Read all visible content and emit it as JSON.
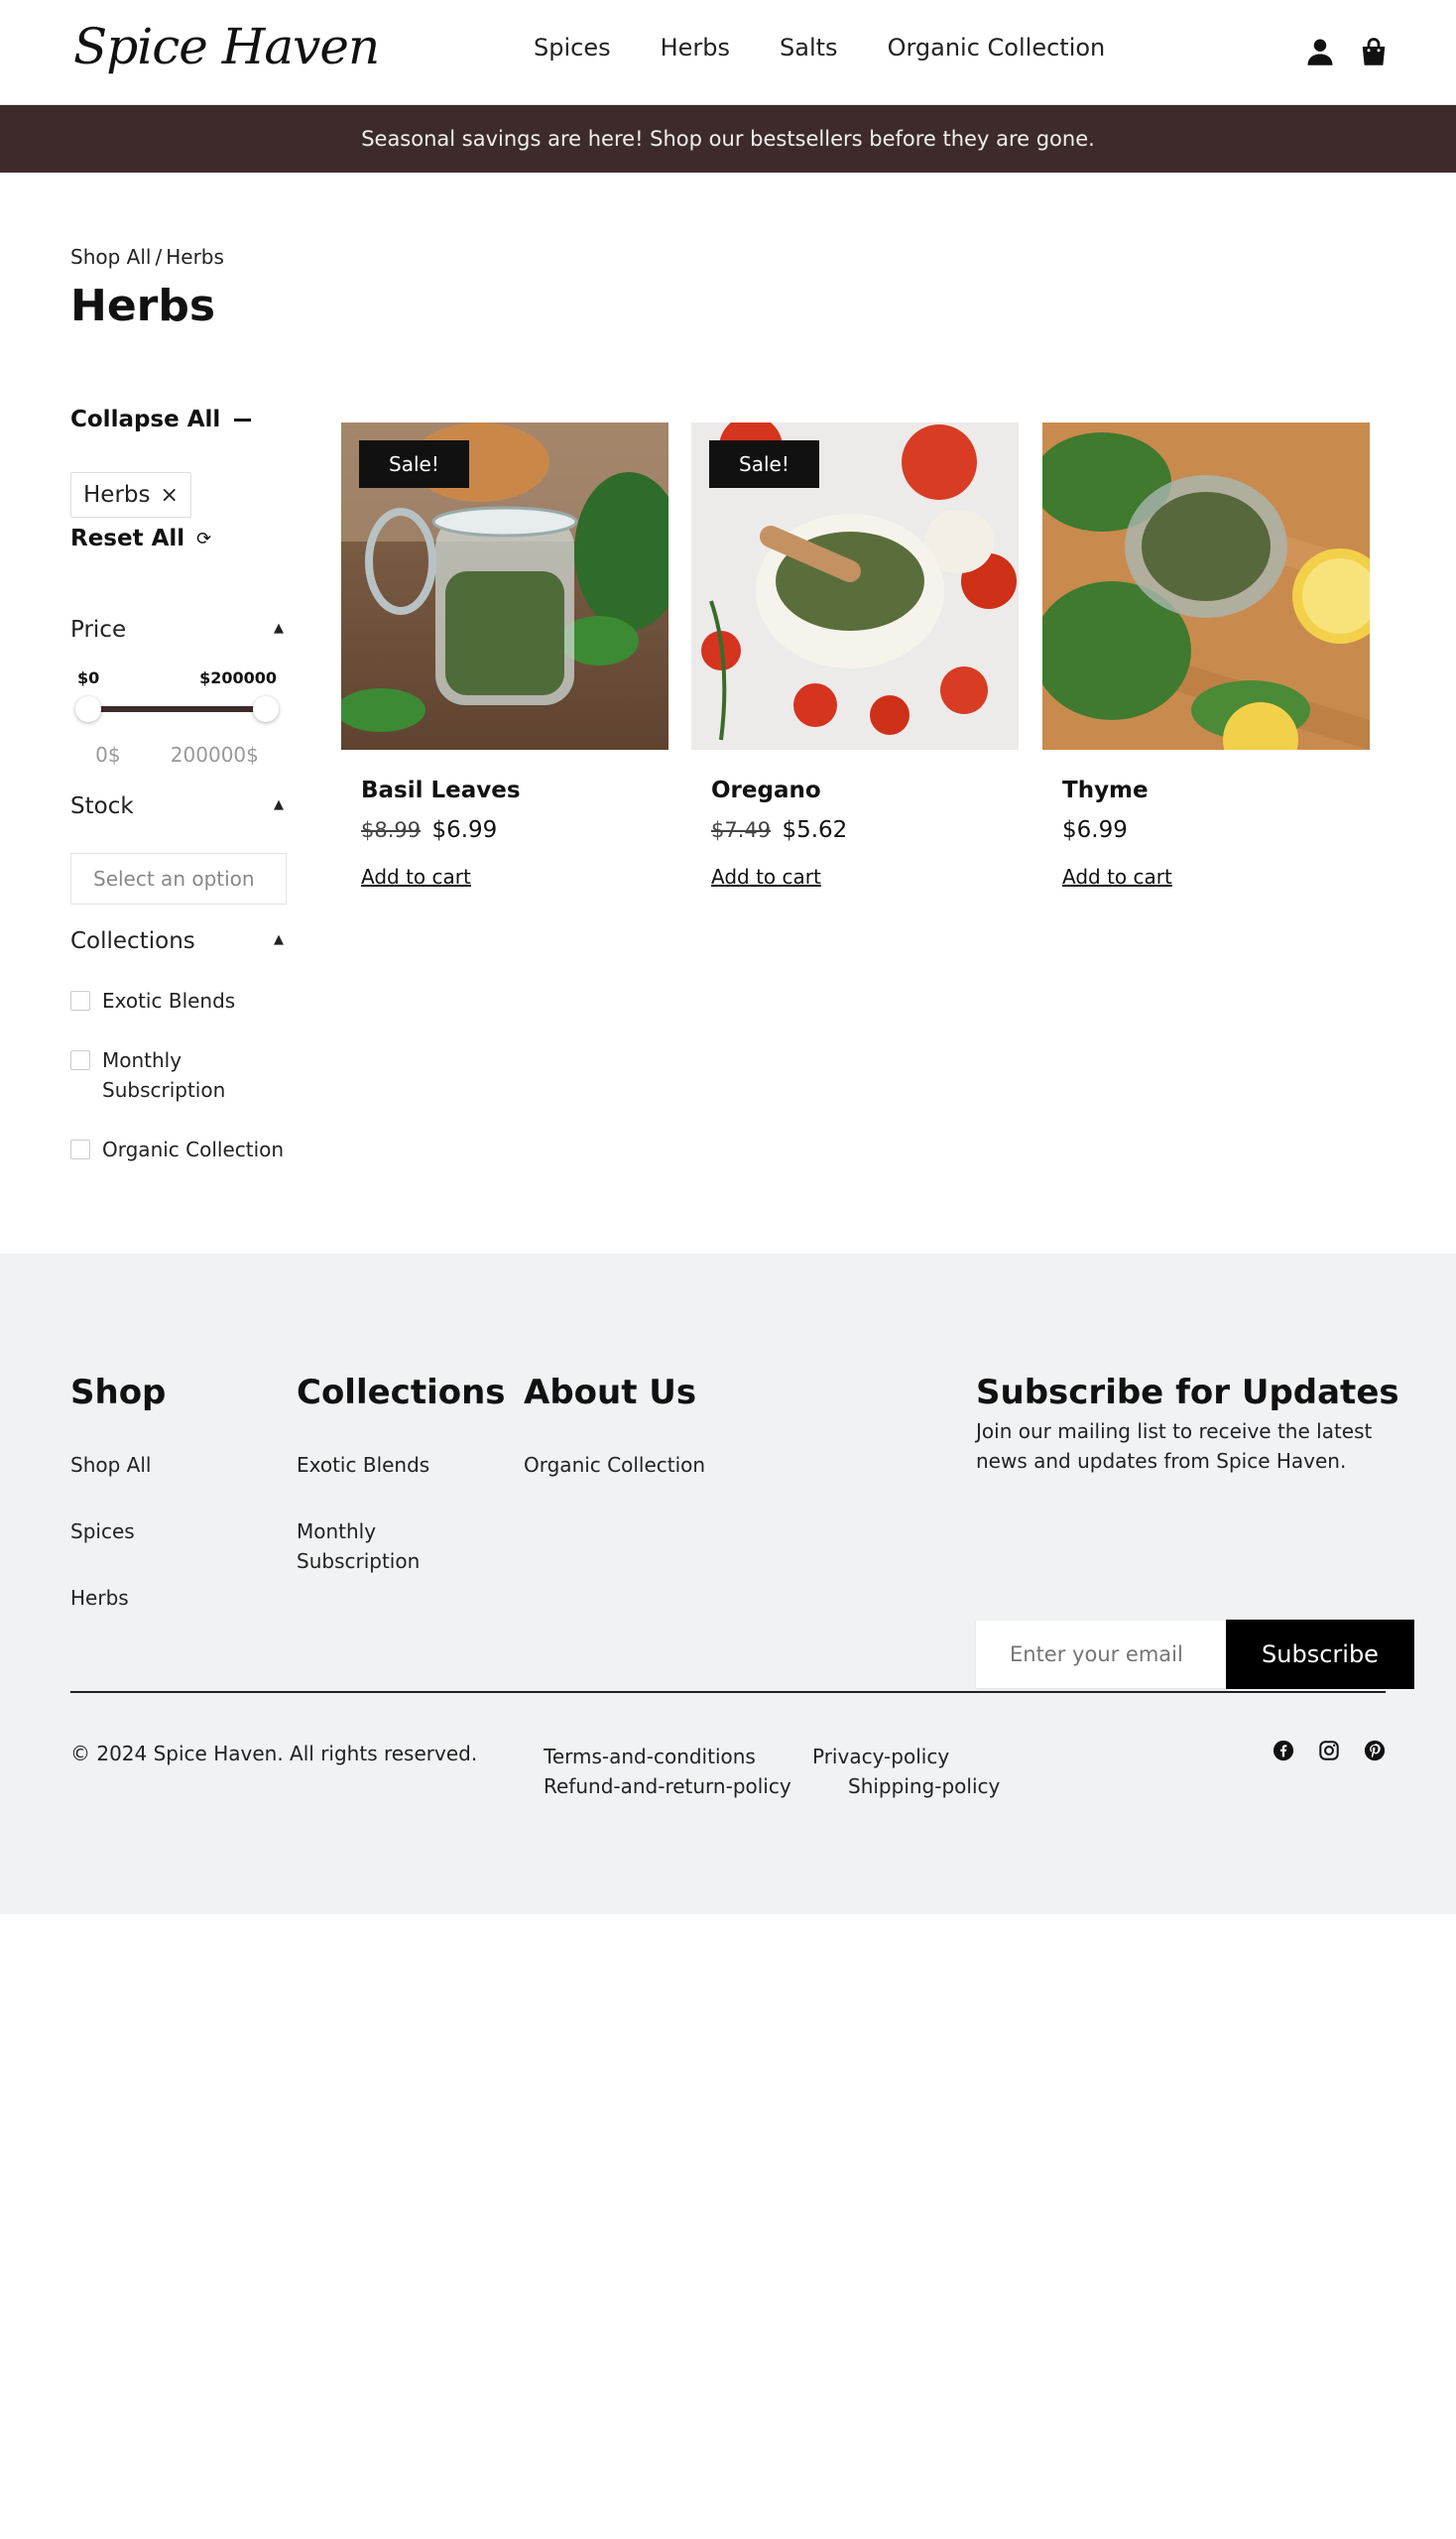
{
  "header": {
    "logo": "Spice Haven",
    "nav": [
      "Spices",
      "Herbs",
      "Salts",
      "Organic Collection"
    ]
  },
  "announcement": "Seasonal savings are here! Shop our bestsellers before they are gone.",
  "breadcrumb": {
    "root": "Shop All",
    "sep": "/",
    "current": "Herbs"
  },
  "page_title": "Herbs",
  "filters": {
    "collapse_all": "Collapse All",
    "active_chip": "Herbs",
    "chip_remove": "×",
    "reset_all": "Reset All",
    "price": {
      "label": "Price",
      "min_label": "$0",
      "max_label": "$200000",
      "min_input": "0$",
      "max_input": "200000$"
    },
    "stock": {
      "label": "Stock",
      "placeholder": "Select an option"
    },
    "collections": {
      "label": "Collections",
      "options": [
        "Exotic Blends",
        "Monthly Subscription",
        "Organic Collection"
      ]
    }
  },
  "products": [
    {
      "name": "Basil Leaves",
      "old_price": "$8.99",
      "price": "$6.99",
      "badge": "Sale!",
      "cta": "Add to cart",
      "image": "basil-jar-image"
    },
    {
      "name": "Oregano",
      "old_price": "$7.49",
      "price": "$5.62",
      "badge": "Sale!",
      "cta": "Add to cart",
      "image": "oregano-bowl-image"
    },
    {
      "name": "Thyme",
      "old_price": "",
      "price": "$6.99",
      "badge": "",
      "cta": "Add to cart",
      "image": "thyme-jar-image"
    }
  ],
  "footer": {
    "shop": {
      "heading": "Shop",
      "links": [
        "Shop All",
        "Spices",
        "Herbs"
      ]
    },
    "collections": {
      "heading": "Collections",
      "links": [
        "Exotic Blends",
        "Monthly Subscription"
      ]
    },
    "about": {
      "heading": "About Us",
      "links": [
        "Organic Collection"
      ]
    },
    "subscribe": {
      "heading": "Subscribe for Updates",
      "text": "Join our mailing list to receive the latest news and updates from Spice Haven.",
      "placeholder": "Enter your email",
      "button": "Subscribe"
    },
    "copyright": "© 2024 Spice Haven. All rights reserved.",
    "legal": [
      "Terms-and-conditions",
      "Privacy-policy",
      "Refund-and-return-policy",
      "Shipping-policy"
    ],
    "socials": [
      "facebook-icon",
      "instagram-icon",
      "pinterest-icon"
    ]
  },
  "colors": {
    "announcement_bg": "#3d2b2b",
    "footer_bg": "#f1f2f4",
    "button_bg": "#000000"
  }
}
